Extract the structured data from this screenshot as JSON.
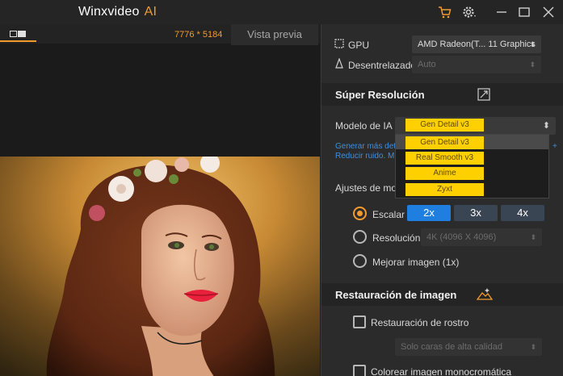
{
  "app": {
    "title": "Winxvideo",
    "title_accent": "AI"
  },
  "preview": {
    "resolution": "7776 * 5184",
    "tab_label": "Vista previa"
  },
  "gpu": {
    "label": "GPU",
    "value": "AMD Radeon(T... 11 Graphics"
  },
  "deinterlace": {
    "label": "Desentrelazado",
    "value": "Auto"
  },
  "super_resolution": {
    "title": "Súper Resolución",
    "model_label": "Modelo de IA",
    "model_value": "Gen Detail v3",
    "model_options": [
      "Gen Detail v3",
      "Real Smooth v3",
      "Anime",
      "Zyxt"
    ],
    "desc_line1": "Generar más det",
    "desc_line1_end": "+",
    "desc_line2": "Reducir ruido. M",
    "settings_label": "Ajustes de mod",
    "scale_label": "Escalar",
    "scale_options": [
      "2x",
      "3x",
      "4x"
    ],
    "resolution_label": "Resolución",
    "resolution_value": "4K (4096 X 4096)",
    "enhance_label": "Mejorar imagen (1x)"
  },
  "restoration": {
    "title": "Restauración de imagen",
    "face_label": "Restauración de rostro",
    "face_value": "Solo caras de alta calidad",
    "colorize_label": "Colorear imagen monocromática"
  },
  "colors": {
    "accent": "#f29a2e",
    "blue": "#1f7fe0",
    "pill": "#ffd000"
  }
}
